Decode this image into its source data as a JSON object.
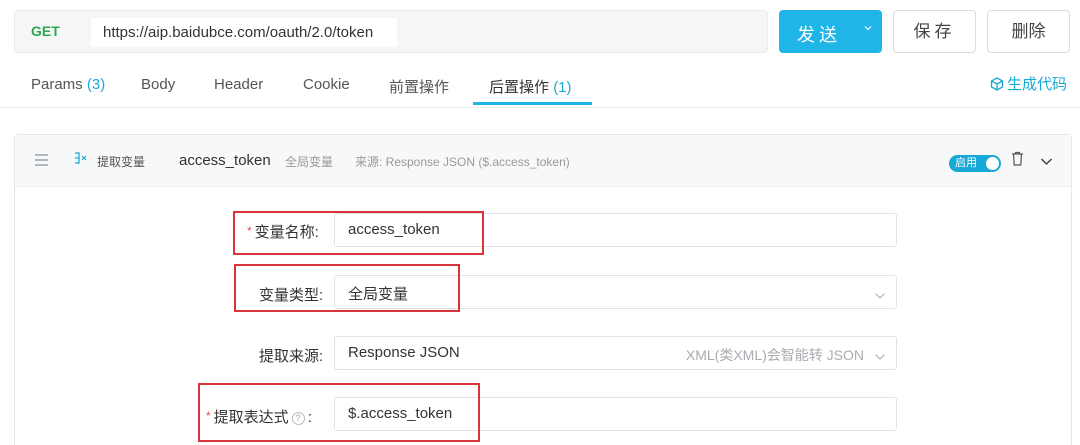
{
  "request": {
    "method": "GET",
    "url": "https://aip.baidubce.com/oauth/2.0/token",
    "send_label": "发送",
    "send_caret": "⌄",
    "save_label": "保存",
    "delete_label": "删除"
  },
  "tabs": [
    {
      "label": "Params",
      "count": "(3)"
    },
    {
      "label": "Body",
      "count": ""
    },
    {
      "label": "Header",
      "count": ""
    },
    {
      "label": "Cookie",
      "count": ""
    },
    {
      "label": "前置操作",
      "count": ""
    },
    {
      "label": "后置操作",
      "count": "(1)",
      "active": true
    }
  ],
  "generate_code": "生成代码",
  "extractor": {
    "type_label": "提取变量",
    "variable_name": "access_token",
    "scope": "全局变量",
    "source_summary": "来源: Response JSON ($.access_token)",
    "enabled_label": "启用",
    "enabled": true
  },
  "form": {
    "name_label": "变量名称:",
    "name_value": "access_token",
    "type_label": "变量类型:",
    "type_value": "全局变量",
    "source_label": "提取来源:",
    "source_value": "Response JSON",
    "source_hint": "XML(类XML)会智能转 JSON",
    "expr_label": "提取表达式",
    "expr_colon": ":",
    "expr_value": "$.access_token",
    "required_mark": "*",
    "help_mark": "?"
  },
  "colors": {
    "accent": "#1fb5e6",
    "method_get": "#2ea84f",
    "highlight": "#d9343b"
  }
}
